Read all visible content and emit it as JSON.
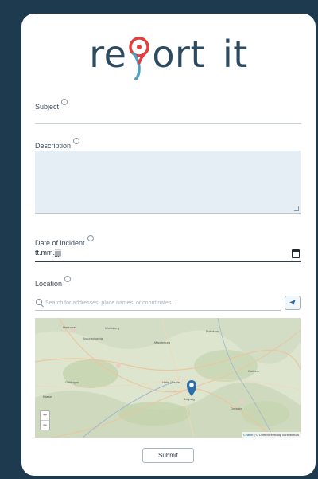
{
  "brand": {
    "logo_left": "re",
    "logo_right": "ort",
    "logo_second_word": "it",
    "text_color": "#2e4a5f",
    "pin_color": "#e23e3e",
    "pin_tail_color": "#4a9fc2"
  },
  "form": {
    "subject_label": "Subject",
    "description_label": "Description",
    "date_label": "Date of incident",
    "date_placeholder": "tt.mm.jjjj",
    "location_label": "Location",
    "search_placeholder": "Search for addresses, place names, or coordinates...",
    "submit_label": "Submit"
  },
  "map": {
    "zoom_in": "+",
    "zoom_out": "−",
    "attribution_link": "Leaflet",
    "attribution_text": "| © OpenStreetMap contributors",
    "places": [
      "Hannover",
      "Wolfsburg",
      "Braunschweig",
      "Magdeburg",
      "Potsdam",
      "Göttingen",
      "Halle (Saale)",
      "Leipzig",
      "Cottbus",
      "Kassel",
      "Dresden"
    ],
    "marker_color": "#2c6fa8"
  },
  "theme": {
    "background": "#1d3a4e",
    "card": "#ffffff",
    "textarea_fill": "#e6eef5"
  }
}
